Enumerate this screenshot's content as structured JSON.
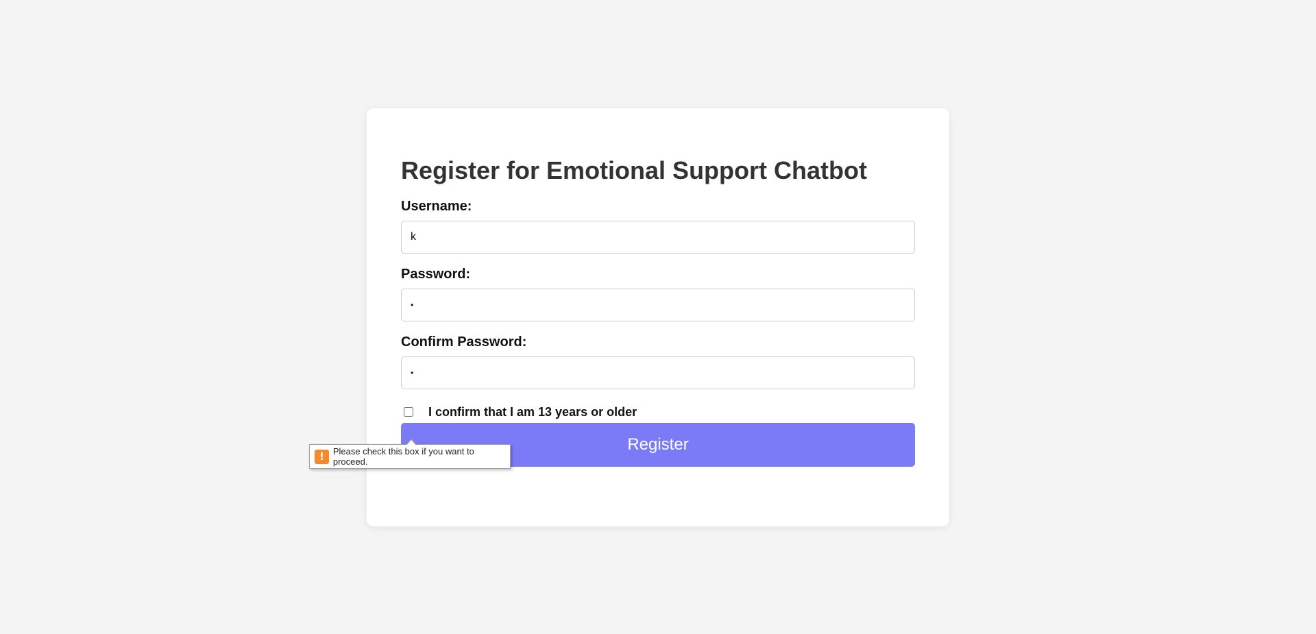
{
  "form": {
    "title": "Register for Emotional Support Chatbot",
    "username": {
      "label": "Username:",
      "value": "k"
    },
    "password": {
      "label": "Password:",
      "value": "a"
    },
    "confirm_password": {
      "label": "Confirm Password:",
      "value": "a"
    },
    "age_confirm": {
      "label": "I confirm that I am 13 years or older",
      "checked": false
    },
    "register_label": "Register"
  },
  "validation_tooltip": {
    "icon": "warning-icon",
    "icon_glyph": "!",
    "message": "Please check this box if you want to proceed."
  },
  "colors": {
    "page_background": "#f4f4f4",
    "card_background": "#ffffff",
    "button_background": "#7b7bf8",
    "warning_icon": "#f38b2c"
  }
}
